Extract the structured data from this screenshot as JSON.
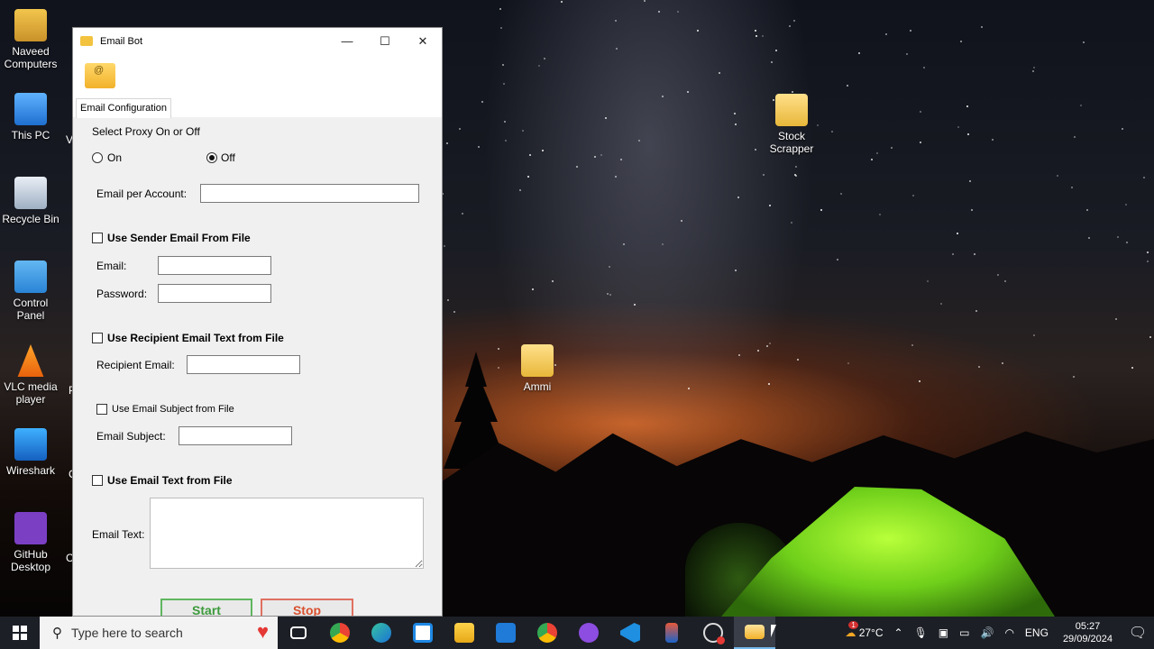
{
  "desktop": {
    "icons": [
      {
        "label": "Naveed Computers",
        "icon": "user-folder-icon"
      },
      {
        "label": "This PC",
        "icon": "computer-icon"
      },
      {
        "label": "Recycle Bin",
        "icon": "recycle-bin-icon"
      },
      {
        "label": "Control Panel",
        "icon": "control-panel-icon"
      },
      {
        "label": "VLC media player",
        "icon": "vlc-icon"
      },
      {
        "label": "Wireshark",
        "icon": "wireshark-icon"
      },
      {
        "label": "GitHub Desktop",
        "icon": "github-icon"
      },
      {
        "label": "Stock Scrapper",
        "icon": "folder-icon"
      },
      {
        "label": "Ammi",
        "icon": "folder-icon"
      }
    ],
    "partial_labels": {
      "v": "V",
      "p": "P",
      "c1": "C",
      "c2": "C"
    }
  },
  "window": {
    "title": "Email Bot",
    "controls": {
      "minimize": "—",
      "maximize": "☐",
      "close": "✕"
    },
    "tab_label": "Email Configuration",
    "form": {
      "proxy_heading": "Select Proxy On or Off",
      "proxy_on": "On",
      "proxy_off": "Off",
      "proxy_selected": "Off",
      "email_per_account_label": "Email per Account:",
      "email_per_account_value": "",
      "use_sender_file": "Use Sender Email From File",
      "email_label": "Email:",
      "email_value": "",
      "password_label": "Password:",
      "password_value": "",
      "use_recipient_file": "Use Recipient Email Text from File",
      "recipient_label": "Recipient Email:",
      "recipient_value": "",
      "use_subject_file": "Use Email Subject from File",
      "subject_label": "Email Subject:",
      "subject_value": "",
      "use_text_file": "Use Email Text from File",
      "email_text_label": "Email Text:",
      "start_label": "Start",
      "stop_label": "Stop"
    }
  },
  "taskbar": {
    "search_placeholder": "Type here to search",
    "apps": [
      "task-view-icon",
      "chrome-icon",
      "edge-icon",
      "store-icon",
      "file-explorer-icon",
      "mail-icon",
      "chrome-profile-icon",
      "github-desktop-icon",
      "vscode-icon",
      "app-icon",
      "app-recording-icon",
      "email-bot-icon"
    ],
    "weather": "27°C",
    "weather_badge": "1",
    "language": "ENG",
    "time": "05:27",
    "date": "29/09/2024"
  },
  "colors": {
    "start_border": "#5fb65f",
    "start_text": "#3c9a3c",
    "stop_border": "#e07060",
    "stop_text": "#d9502e",
    "taskbar": "#1c1f26"
  }
}
